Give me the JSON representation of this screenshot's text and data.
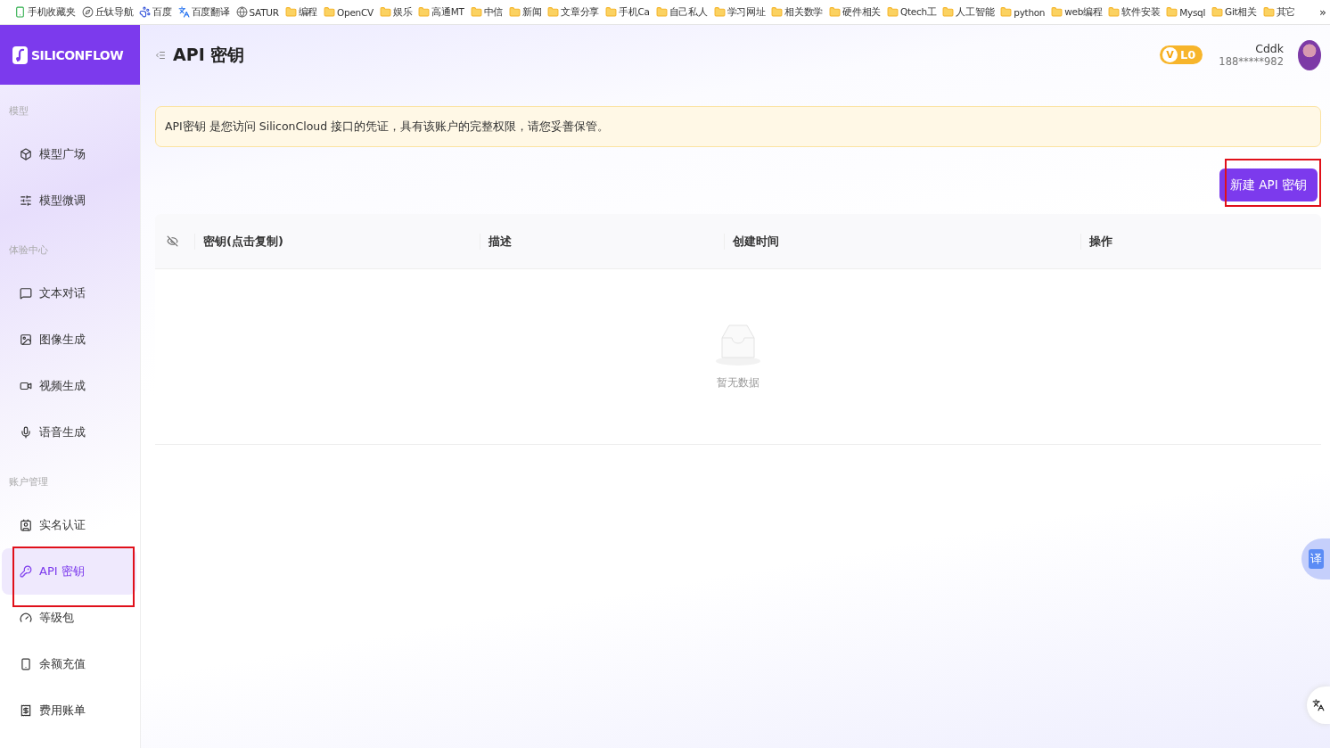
{
  "bookmarks": [
    {
      "label": "手机收藏夹",
      "kind": "phone"
    },
    {
      "label": "丘钛导航",
      "kind": "site"
    },
    {
      "label": "百度",
      "kind": "paw"
    },
    {
      "label": "百度翻译",
      "kind": "translate"
    },
    {
      "label": "SATUR",
      "kind": "globe"
    },
    {
      "label": "编程",
      "kind": "folder"
    },
    {
      "label": "OpenCV",
      "kind": "folder"
    },
    {
      "label": "娱乐",
      "kind": "folder"
    },
    {
      "label": "高通MT",
      "kind": "folder"
    },
    {
      "label": "中信",
      "kind": "folder"
    },
    {
      "label": "新闻",
      "kind": "folder"
    },
    {
      "label": "文章分享",
      "kind": "folder"
    },
    {
      "label": "手机Ca",
      "kind": "folder"
    },
    {
      "label": "自己私人",
      "kind": "folder"
    },
    {
      "label": "学习网址",
      "kind": "folder"
    },
    {
      "label": "相关数学",
      "kind": "folder"
    },
    {
      "label": "硬件相关",
      "kind": "folder"
    },
    {
      "label": "Qtech工",
      "kind": "folder"
    },
    {
      "label": "人工智能",
      "kind": "folder"
    },
    {
      "label": "python",
      "kind": "folder"
    },
    {
      "label": "web编程",
      "kind": "folder"
    },
    {
      "label": "软件安装",
      "kind": "folder"
    },
    {
      "label": "Mysql",
      "kind": "folder"
    },
    {
      "label": "Git相关",
      "kind": "folder"
    },
    {
      "label": "其它",
      "kind": "folder"
    }
  ],
  "bookmarks_more": "»",
  "logo": "SILICONFLOW",
  "sidebar": {
    "sections": [
      {
        "title": "模型",
        "items": [
          {
            "label": "模型广场",
            "selected": false,
            "highlighted": false
          },
          {
            "label": "模型微调",
            "selected": false,
            "highlighted": false
          }
        ]
      },
      {
        "title": "体验中心",
        "items": [
          {
            "label": "文本对话",
            "selected": false,
            "highlighted": false
          },
          {
            "label": "图像生成",
            "selected": false,
            "highlighted": false
          },
          {
            "label": "视频生成",
            "selected": false,
            "highlighted": false
          },
          {
            "label": "语音生成",
            "selected": false,
            "highlighted": false
          }
        ]
      },
      {
        "title": "账户管理",
        "items": [
          {
            "label": "实名认证",
            "selected": false,
            "highlighted": false
          },
          {
            "label": "API 密钥",
            "selected": true,
            "highlighted": true
          },
          {
            "label": "等级包",
            "selected": false,
            "highlighted": false
          },
          {
            "label": "余额充值",
            "selected": false,
            "highlighted": false
          },
          {
            "label": "费用账单",
            "selected": false,
            "highlighted": false
          }
        ]
      }
    ]
  },
  "page_title": "API 密钥",
  "user": {
    "level_badge": "L0",
    "level_letter": "V",
    "name": "Cddk",
    "phone": "188*****982"
  },
  "notice": "API密钥 是您访问 SiliconCloud 接口的凭证，具有该账户的完整权限，请您妥善保管。",
  "new_key_button": {
    "label": "新建 API 密钥",
    "highlighted": true
  },
  "table": {
    "columns": [
      "密钥(点击复制)",
      "描述",
      "创建时间",
      "操作"
    ],
    "empty_text": "暂无数据"
  },
  "translate_button": "译"
}
